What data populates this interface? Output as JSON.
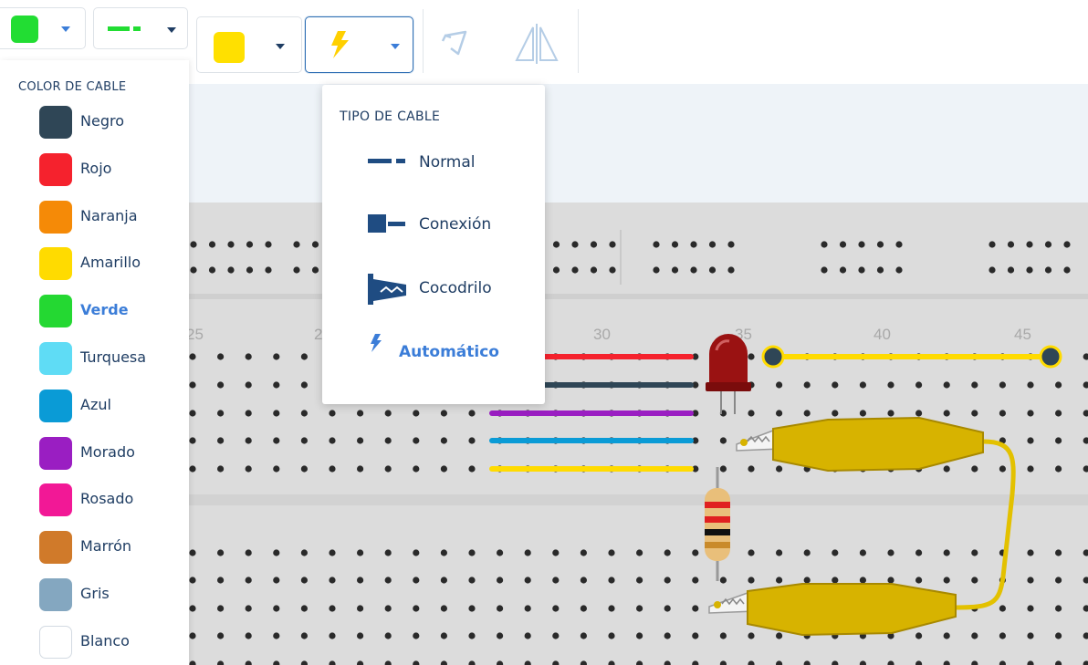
{
  "toolbar": {
    "color_picker": {
      "color": "#22dd33",
      "icon": "color-swatch"
    },
    "style_picker": {
      "icon": "cable-style-icon",
      "color": "#22dd33"
    },
    "wire_color_button": {
      "color": "#ffe000",
      "icon": "color-swatch"
    },
    "cable_type_button": {
      "icon": "lightning-icon",
      "color": "#ffe000",
      "active": true
    },
    "rotate_button": {
      "icon": "rotate-icon",
      "disabled": true
    },
    "flip_button": {
      "icon": "flip-icon",
      "disabled": true
    }
  },
  "color_menu": {
    "title": "COLOR DE CABLE",
    "items": [
      {
        "label": "Negro",
        "color": "#2f4656"
      },
      {
        "label": "Rojo",
        "color": "#f5222d"
      },
      {
        "label": "Naranja",
        "color": "#f58a07"
      },
      {
        "label": "Amarillo",
        "color": "#ffdb00"
      },
      {
        "label": "Verde",
        "color": "#24d832",
        "selected": true
      },
      {
        "label": "Turquesa",
        "color": "#5fdcf5"
      },
      {
        "label": "Azul",
        "color": "#0a9bd6"
      },
      {
        "label": "Morado",
        "color": "#9a1ec2"
      },
      {
        "label": "Rosado",
        "color": "#f21896"
      },
      {
        "label": "Marrón",
        "color": "#d07a2a"
      },
      {
        "label": "Gris",
        "color": "#84a7c0"
      },
      {
        "label": "Blanco",
        "color": "#ffffff"
      }
    ]
  },
  "cable_type_menu": {
    "title": "TIPO DE CABLE",
    "items": [
      {
        "label": "Normal",
        "icon": "normal-cable-icon"
      },
      {
        "label": "Conexión",
        "icon": "connection-cable-icon"
      },
      {
        "label": "Cocodrilo",
        "icon": "alligator-clip-icon"
      },
      {
        "label": "Automático",
        "icon": "lightning-icon",
        "selected": true
      }
    ]
  },
  "breadboard": {
    "column_numbers": [
      "25",
      "2",
      "30",
      "35",
      "40",
      "45"
    ],
    "wires": [
      {
        "color": "#f5222d"
      },
      {
        "color": "#2f4656"
      },
      {
        "color": "#9a1ec2"
      },
      {
        "color": "#0a9bd6"
      },
      {
        "color": "#ffdb00"
      },
      {
        "color": "#ffdb00"
      }
    ],
    "components": [
      {
        "type": "led",
        "color": "#a01010"
      },
      {
        "type": "resistor",
        "bands": [
          "#e02020",
          "#e02020",
          "#111111"
        ]
      },
      {
        "type": "alligator-clip",
        "color": "#d7b300"
      },
      {
        "type": "alligator-clip",
        "color": "#d7b300"
      }
    ]
  }
}
